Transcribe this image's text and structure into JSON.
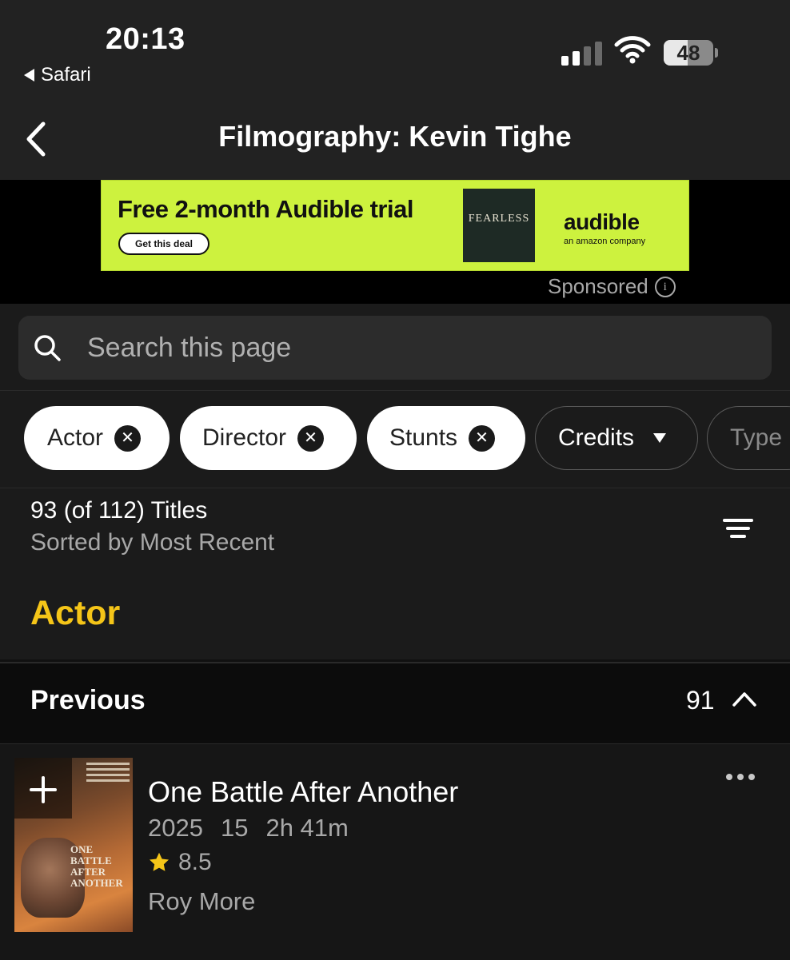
{
  "status_bar": {
    "time": "20:13",
    "back_app": "Safari",
    "battery": "48",
    "battery_level": 0.48
  },
  "nav": {
    "title": "Filmography: Kevin Tighe"
  },
  "ad": {
    "headline": "Free 2-month Audible trial",
    "cta": "Get this deal",
    "book_title": "FEARLESS",
    "brand": "audible",
    "brand_sub": "an amazon company",
    "sponsored": "Sponsored"
  },
  "search": {
    "placeholder": "Search this page"
  },
  "filters": [
    {
      "label": "Actor",
      "selected": true
    },
    {
      "label": "Director",
      "selected": true
    },
    {
      "label": "Stunts",
      "selected": true
    },
    {
      "label": "Credits",
      "selected": false
    },
    {
      "label": "Type",
      "selected": false
    }
  ],
  "results": {
    "count": "93 (of 112) Titles",
    "sort": "Sorted by Most Recent"
  },
  "section": {
    "title": "Actor"
  },
  "group": {
    "label": "Previous",
    "count": "91"
  },
  "items": [
    {
      "title": "One Battle After Another",
      "year": "2025",
      "rating_cert": "15",
      "runtime": "2h 41m",
      "rating": "8.5",
      "role": "Roy More",
      "poster_text": "ONE BATTLE AFTER ANOTHER"
    }
  ],
  "colors": {
    "accent": "#f5c518",
    "ad_bg": "#cdf23e",
    "background": "#111111"
  }
}
